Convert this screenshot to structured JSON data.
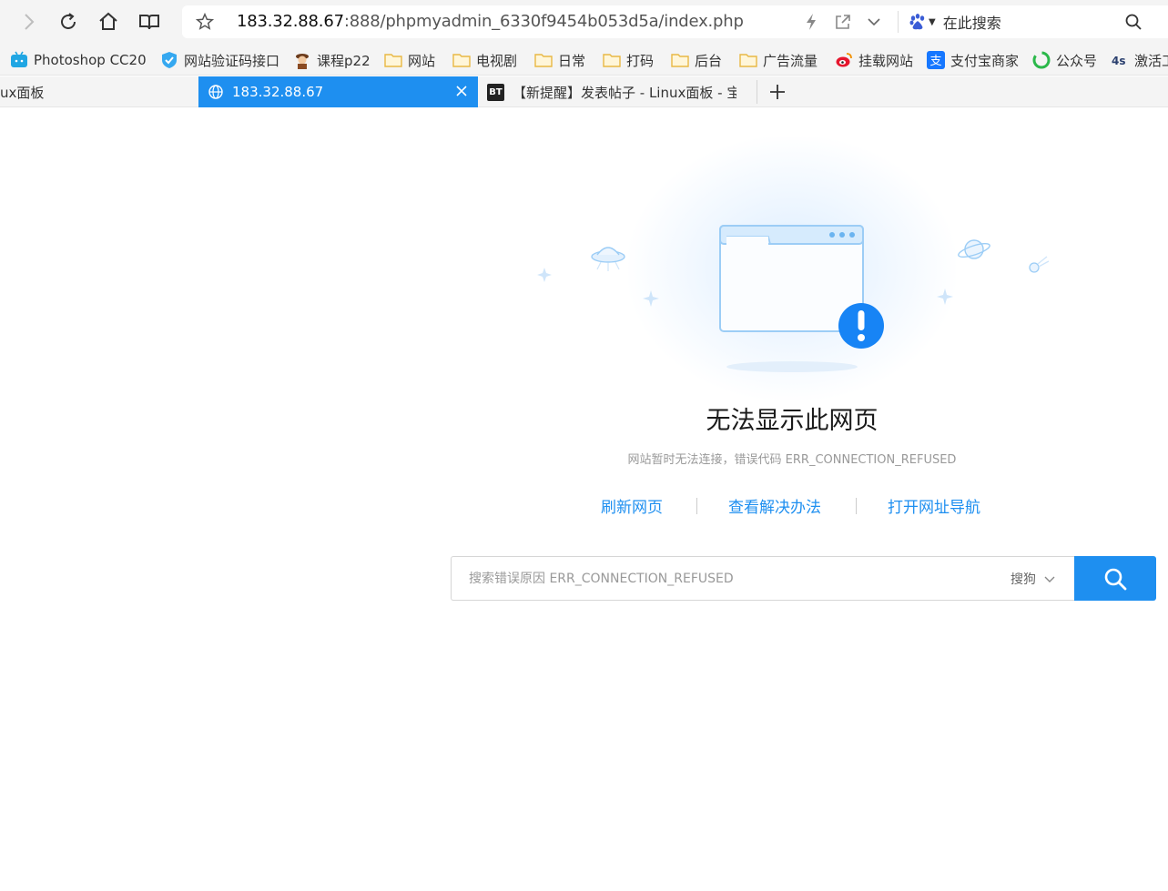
{
  "toolbar": {
    "url_host": "183.32.88.67",
    "url_rest": ":888/phpmyadmin_6330f9454b053d5a/index.php",
    "search_placeholder": "在此搜索"
  },
  "bookmarks": [
    {
      "label": "Photoshop CC20",
      "icon": "bilibili-icon"
    },
    {
      "label": "网站验证码接口",
      "icon": "shield-check-icon"
    },
    {
      "label": "课程p22",
      "icon": "avatar-icon"
    },
    {
      "label": "网站",
      "icon": "folder-icon"
    },
    {
      "label": "电视剧",
      "icon": "folder-icon"
    },
    {
      "label": "日常",
      "icon": "folder-icon"
    },
    {
      "label": "打码",
      "icon": "folder-icon"
    },
    {
      "label": "后台",
      "icon": "folder-icon"
    },
    {
      "label": "广告流量",
      "icon": "folder-icon"
    },
    {
      "label": "挂载网站",
      "icon": "weibo-icon"
    },
    {
      "label": "支付宝商家",
      "icon": "alipay-icon"
    },
    {
      "label": "公众号",
      "icon": "wechat-icon"
    },
    {
      "label": "激活工",
      "icon": "site-icon"
    }
  ],
  "tabs": [
    {
      "label": "ux面板",
      "active": false
    },
    {
      "label": "183.32.88.67",
      "active": true
    },
    {
      "label": "【新提醒】发表帖子 - Linux面板 - 宝",
      "badge": "BT",
      "active": false
    }
  ],
  "error": {
    "title": "无法显示此网页",
    "description": "网站暂时无法连接，错误代码 ERR_CONNECTION_REFUSED",
    "links": [
      "刷新网页",
      "查看解决办法",
      "打开网址导航"
    ],
    "search_placeholder": "搜索错误原因 ERR_CONNECTION_REFUSED",
    "engine": "搜狗"
  },
  "colors": {
    "accent": "#1e8ff0",
    "illustration_blue": "#9ccdf6",
    "alert": "#1784f5"
  }
}
